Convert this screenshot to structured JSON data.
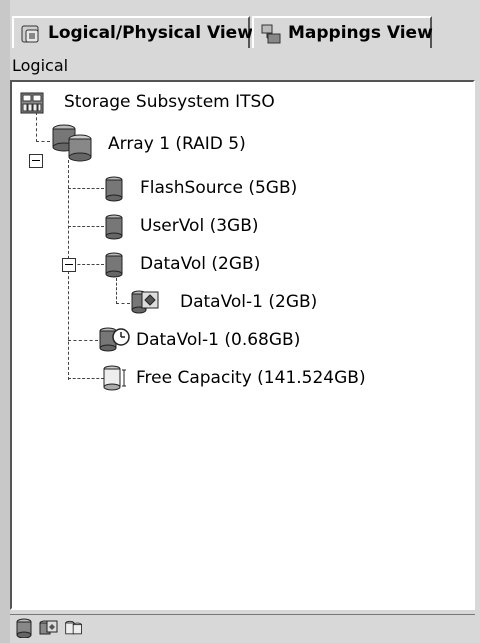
{
  "tabs": [
    {
      "label": "Logical/Physical View",
      "icon": "logical-view-icon",
      "selected": true
    },
    {
      "label": "Mappings View",
      "icon": "mappings-view-icon",
      "selected": false
    }
  ],
  "section_label": "Logical",
  "tree": {
    "root": {
      "label": "Storage Subsystem ITSO",
      "icon": "storage-subsystem-icon"
    },
    "array": {
      "label": "Array 1 (RAID 5)",
      "icon": "array-icon",
      "expanded": true
    },
    "children": [
      {
        "label": "FlashSource (5GB)",
        "icon": "volume-icon"
      },
      {
        "label": "UserVol (3GB)",
        "icon": "volume-icon"
      },
      {
        "label": "DataVol (2GB)",
        "icon": "volume-icon",
        "expanded": true
      },
      {
        "label": "DataVol-1 (2GB)",
        "icon": "volume-copy-icon"
      },
      {
        "label": "DataVol-1 (0.68GB)",
        "icon": "flashcopy-repository-icon"
      },
      {
        "label": "Free Capacity (141.524GB)",
        "icon": "free-capacity-icon"
      }
    ]
  },
  "status_bar": {
    "icons": [
      "volume-status-icon",
      "copy-status-icon",
      "capacity-status-icon"
    ]
  }
}
